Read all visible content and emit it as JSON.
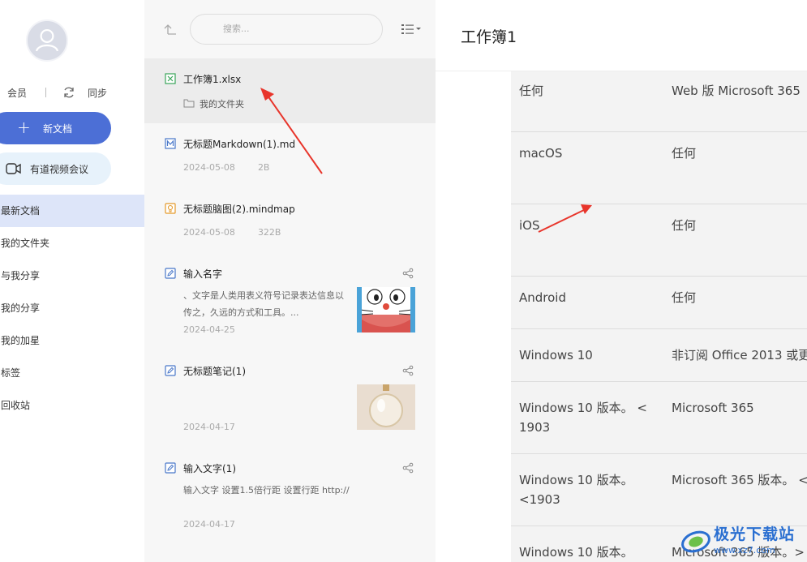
{
  "sidebar": {
    "vip_label": "会员",
    "sync_label": "同步",
    "new_doc_label": "新文档",
    "meeting_label": "有道视频会议",
    "nav": [
      {
        "label": "最新文档",
        "active": true
      },
      {
        "label": "我的文件夹"
      },
      {
        "label": "与我分享"
      },
      {
        "label": "我的分享"
      },
      {
        "label": "我的加星"
      },
      {
        "label": "标签"
      },
      {
        "label": "回收站"
      }
    ]
  },
  "list": {
    "search_placeholder": "搜索...",
    "files": [
      {
        "name": "工作簿1.xlsx",
        "type": "xlsx",
        "folder": "我的文件夹"
      },
      {
        "name": "无标题Markdown(1).md",
        "type": "md",
        "date": "2024-05-08",
        "size": "2B"
      },
      {
        "name": "无标题脑图(2).mindmap",
        "type": "mindmap",
        "date": "2024-05-08",
        "size": "322B"
      },
      {
        "name": "输入名字",
        "type": "note",
        "snippet": "、文字是人类用表义符号记录表达信息以传之，久远的方式和工具。...",
        "date": "2024-04-25"
      },
      {
        "name": "无标题笔记(1)",
        "type": "note",
        "date": "2024-04-17"
      },
      {
        "name": "输入文字(1)",
        "type": "note",
        "snippet": "输入文字 设置1.5倍行距 设置行距 http://",
        "date": "2024-04-17"
      }
    ]
  },
  "doc": {
    "title": "工作簿1",
    "rows": [
      {
        "c1": "任何",
        "c2": "Web 版 Microsoft 365"
      },
      {
        "c1": "macOS",
        "c2": "任何"
      },
      {
        "c1": "iOS",
        "c2": "任何"
      },
      {
        "c1": "Android",
        "c2": "任何"
      },
      {
        "c1": "Windows 10",
        "c2": "非订阅 Office 2013 或更"
      },
      {
        "c1": "Windows 10 版本。 < 1903",
        "c2": "Microsoft 365"
      },
      {
        "c1": "Windows 10 版本。 <1903",
        "c2": "Microsoft 365 版本。 <"
      },
      {
        "c1": "Windows 10 版本。",
        "c2": "Microsoft 365 版本。>"
      }
    ]
  },
  "watermark": {
    "text": "极光下载站",
    "url": "www.xz7.com"
  },
  "colors": {
    "accent": "#4c6fd6",
    "active_nav": "#dde5f9",
    "arrow": "#e8352b"
  }
}
